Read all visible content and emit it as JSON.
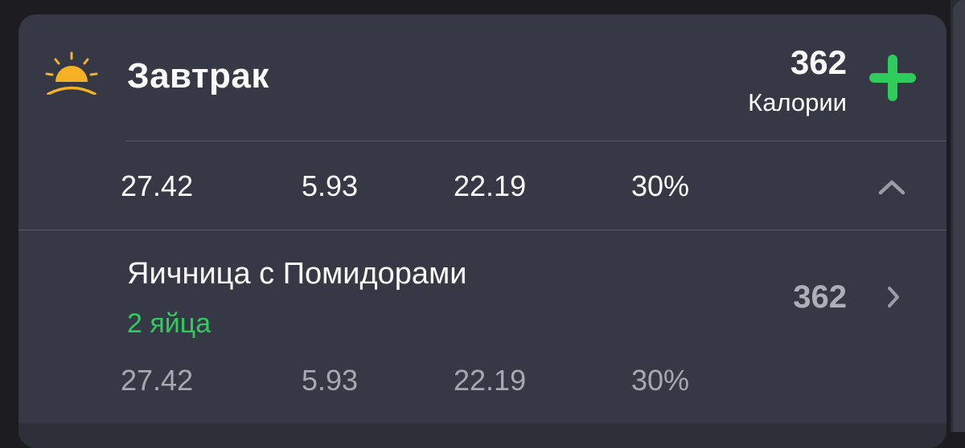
{
  "meal": {
    "icon": "sunrise-icon",
    "title": "Завтрак",
    "calories_value": "362",
    "calories_label": "Калории",
    "add_icon": "plus-icon",
    "accent_color": "#2ecc5b",
    "summary": {
      "values": [
        "27.42",
        "5.93",
        "22.19",
        "30%"
      ],
      "collapse_icon": "chevron-up-icon"
    }
  },
  "food_items": [
    {
      "name": "Яичница с Помидорами",
      "portion": "2 яйца",
      "calories": "362",
      "values": [
        "27.42",
        "5.93",
        "22.19",
        "30%"
      ],
      "detail_icon": "chevron-right-icon"
    }
  ]
}
